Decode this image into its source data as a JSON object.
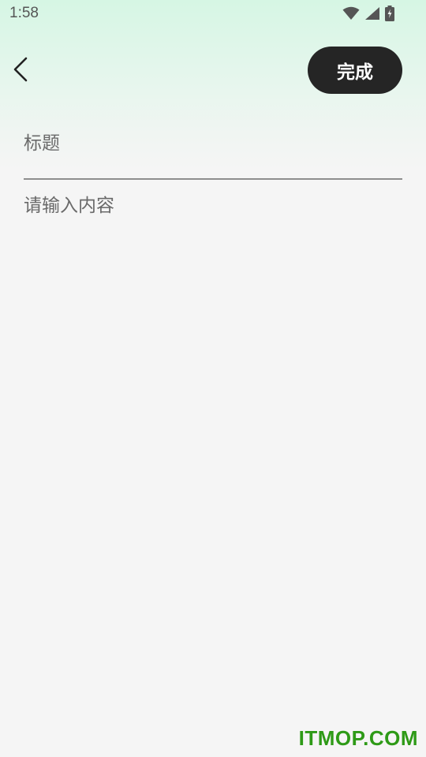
{
  "status_bar": {
    "time": "1:58",
    "icons": [
      "wifi-icon",
      "cellular-signal-icon",
      "battery-charging-icon"
    ]
  },
  "header": {
    "back_icon": "chevron-left-icon",
    "done_label": "完成"
  },
  "form": {
    "title_placeholder": "标题",
    "title_value": "",
    "content_placeholder": "请输入内容",
    "content_value": ""
  },
  "watermark": {
    "text": "ITMOP.COM"
  },
  "colors": {
    "done_button_bg": "#252525",
    "watermark": "#2e9a17",
    "top_gradient": "#d6f6e4",
    "background": "#f5f5f5"
  }
}
